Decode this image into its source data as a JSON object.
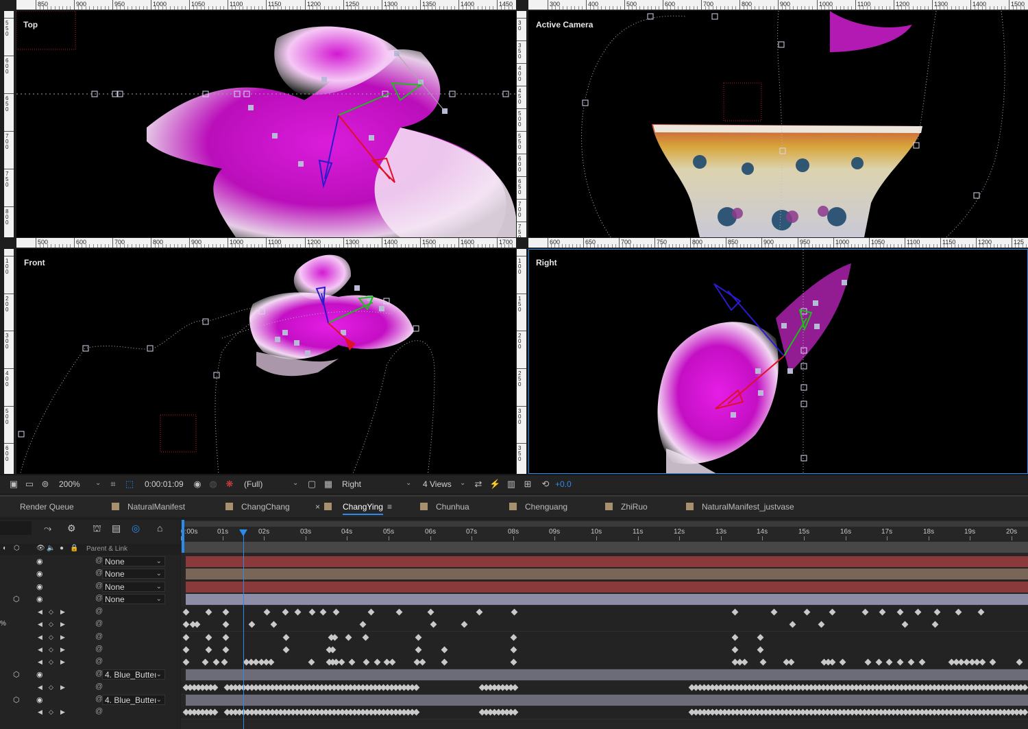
{
  "viewers": {
    "top": {
      "label": "Top",
      "ruler_h": [
        "850",
        "900",
        "950",
        "1000",
        "1050",
        "1100",
        "1150",
        "1200",
        "1250",
        "1300",
        "1350",
        "1400",
        "1450"
      ],
      "ruler_v": [
        "5\n5\n0",
        "6\n0\n0",
        "6\n5\n0",
        "7\n0\n0",
        "7\n5\n0",
        "8\n0\n0"
      ]
    },
    "active_camera": {
      "label": "Active Camera",
      "ruler_h": [
        "300",
        "400",
        "500",
        "600",
        "700",
        "800",
        "900",
        "1000",
        "1100",
        "1200",
        "1300",
        "1400",
        "1500"
      ],
      "ruler_v": [
        "3\n0",
        "3\n5\n0",
        "4\n0\n0",
        "4\n5\n0",
        "5\n0\n0",
        "5\n5\n0",
        "6\n0\n0",
        "6\n5\n0",
        "7\n0\n0",
        "7\n5\n0"
      ]
    },
    "front": {
      "label": "Front",
      "ruler_h": [
        "500",
        "600",
        "700",
        "800",
        "900",
        "1000",
        "1100",
        "1200",
        "1300",
        "1400",
        "1500",
        "1600",
        "1700"
      ],
      "ruler_v": [
        "1\n0\n0",
        "2\n0\n0",
        "3\n0\n0",
        "4\n0\n0",
        "5\n0\n0",
        "6\n0\n0"
      ]
    },
    "right": {
      "label": "Right",
      "ruler_h": [
        "600",
        "650",
        "700",
        "750",
        "800",
        "850",
        "900",
        "950",
        "1000",
        "1050",
        "1100",
        "1150",
        "1200",
        "125"
      ],
      "ruler_v": [
        "1\n0\n0",
        "1\n5\n0",
        "2\n0\n0",
        "2\n5\n0",
        "3\n0\n0",
        "3\n5\n0"
      ]
    }
  },
  "toolbar": {
    "zoom": "200%",
    "timecode": "0:00:01:09",
    "resolution": "(Full)",
    "view": "Right",
    "layout": "4 Views",
    "exposure": "+0.0"
  },
  "tabs": [
    {
      "label": "Render Queue",
      "swatch": false,
      "active": false
    },
    {
      "label": "NaturalManifest",
      "swatch": true,
      "active": false
    },
    {
      "label": "ChangChang",
      "swatch": true,
      "active": false
    },
    {
      "label": "ChangYing",
      "swatch": true,
      "active": true
    },
    {
      "label": "Chunhua",
      "swatch": true,
      "active": false
    },
    {
      "label": "Chenguang",
      "swatch": true,
      "active": false
    },
    {
      "label": "ZhiRuo",
      "swatch": true,
      "active": false
    },
    {
      "label": "NaturalManifest_justvase",
      "swatch": true,
      "active": false
    }
  ],
  "timeline": {
    "ruler": [
      "0:00s",
      "01s",
      "02s",
      "03s",
      "04s",
      "05s",
      "06s",
      "07s",
      "08s",
      "09s",
      "10s",
      "11s",
      "12s",
      "13s",
      "14s",
      "15s",
      "16s",
      "17s",
      "18s",
      "19s",
      "20s"
    ],
    "parent_header": "Parent & Link",
    "playhead_position_seconds": 1.38,
    "layers": [
      {
        "parent": "None",
        "color": "#8a3a3a"
      },
      {
        "parent": "None",
        "color": "#7a6657"
      },
      {
        "parent": "None",
        "color": "#8a3a3a"
      },
      {
        "parent": "None",
        "color": "#8d8da8"
      },
      {
        "parent": "4. Blue_Butteı",
        "color": "#6c6c78"
      },
      {
        "parent": "4. Blue_Butteı",
        "color": "#6c6c78"
      }
    ],
    "left_glyphs": {
      "row5_mark": "%"
    }
  },
  "colors": {
    "accent_blue": "#2d8ceb",
    "butterfly_magenta": "#e020e0",
    "axis_red": "#e0102a",
    "axis_green": "#18c018",
    "axis_blue": "#2a1ad0"
  }
}
